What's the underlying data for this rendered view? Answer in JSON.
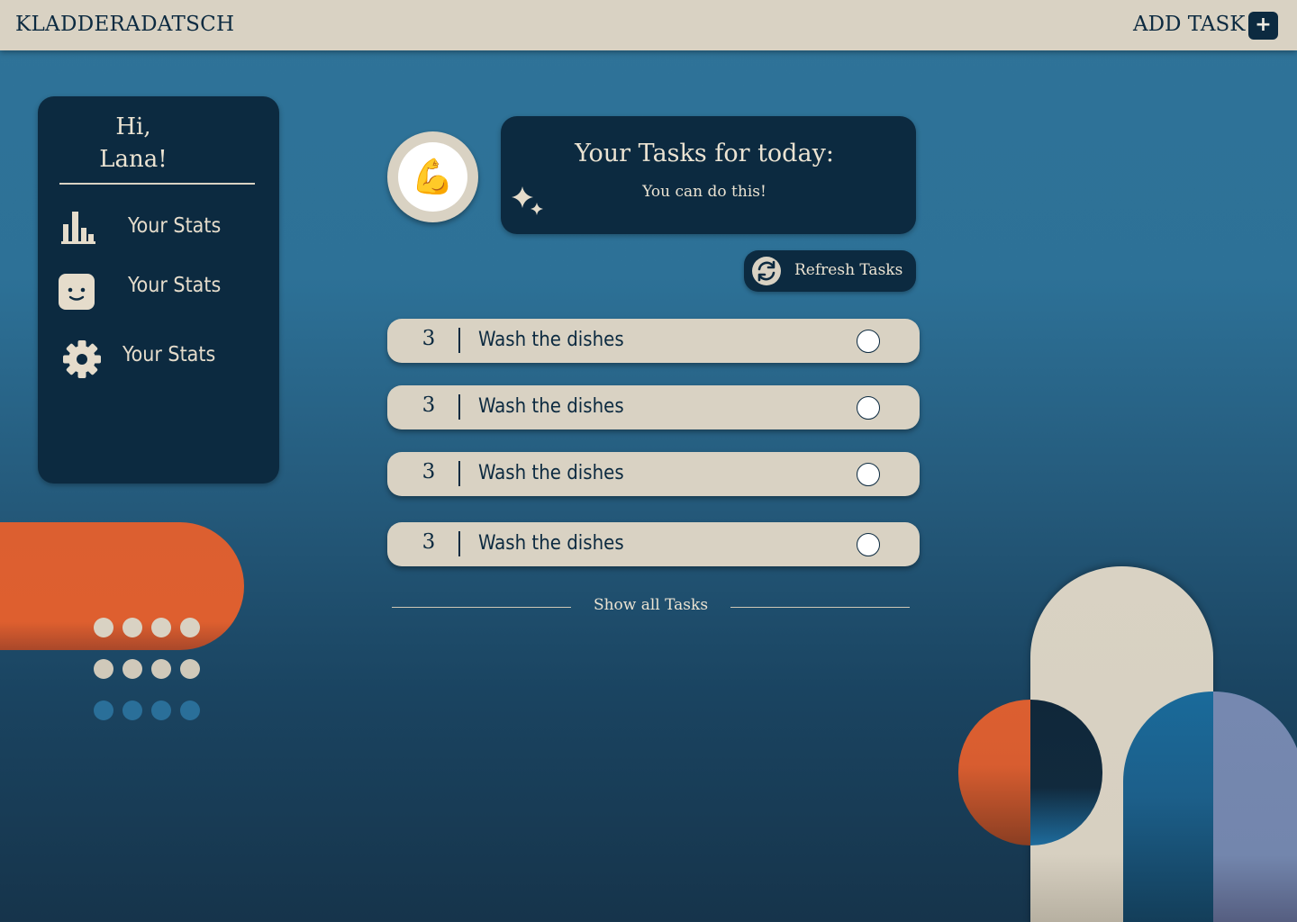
{
  "header": {
    "brand": "KLADDERADATSCH",
    "add_task_label": "ADD TASK",
    "add_task_button": "+"
  },
  "sidebar": {
    "greeting_line1": "Hi,",
    "greeting_line2": "Lana!",
    "items": [
      {
        "label": "Your Stats",
        "icon": "bar-chart-icon"
      },
      {
        "label": "Your Stats",
        "icon": "smiley-face-icon"
      },
      {
        "label": "Your Stats",
        "icon": "gear-icon"
      }
    ]
  },
  "hero": {
    "avatar_emoji": "💪",
    "title": "Your Tasks for today:",
    "subtitle": "You can do this!",
    "icon": "sparkle-icon"
  },
  "refresh": {
    "label": "Refresh Tasks",
    "icon": "refresh-icon"
  },
  "tasks": [
    {
      "points": "3",
      "title": "Wash the dishes",
      "done": false
    },
    {
      "points": "3",
      "title": "Wash the dishes",
      "done": false
    },
    {
      "points": "3",
      "title": "Wash the dishes",
      "done": false
    },
    {
      "points": "3",
      "title": "Wash the dishes",
      "done": false
    }
  ],
  "show_all_label": "Show all Tasks",
  "colors": {
    "navy": "#0c2a40",
    "cream": "#d9d2c3",
    "orange": "#dc5f30",
    "blue": "#2f7398",
    "periwinkle": "#7688b0"
  }
}
